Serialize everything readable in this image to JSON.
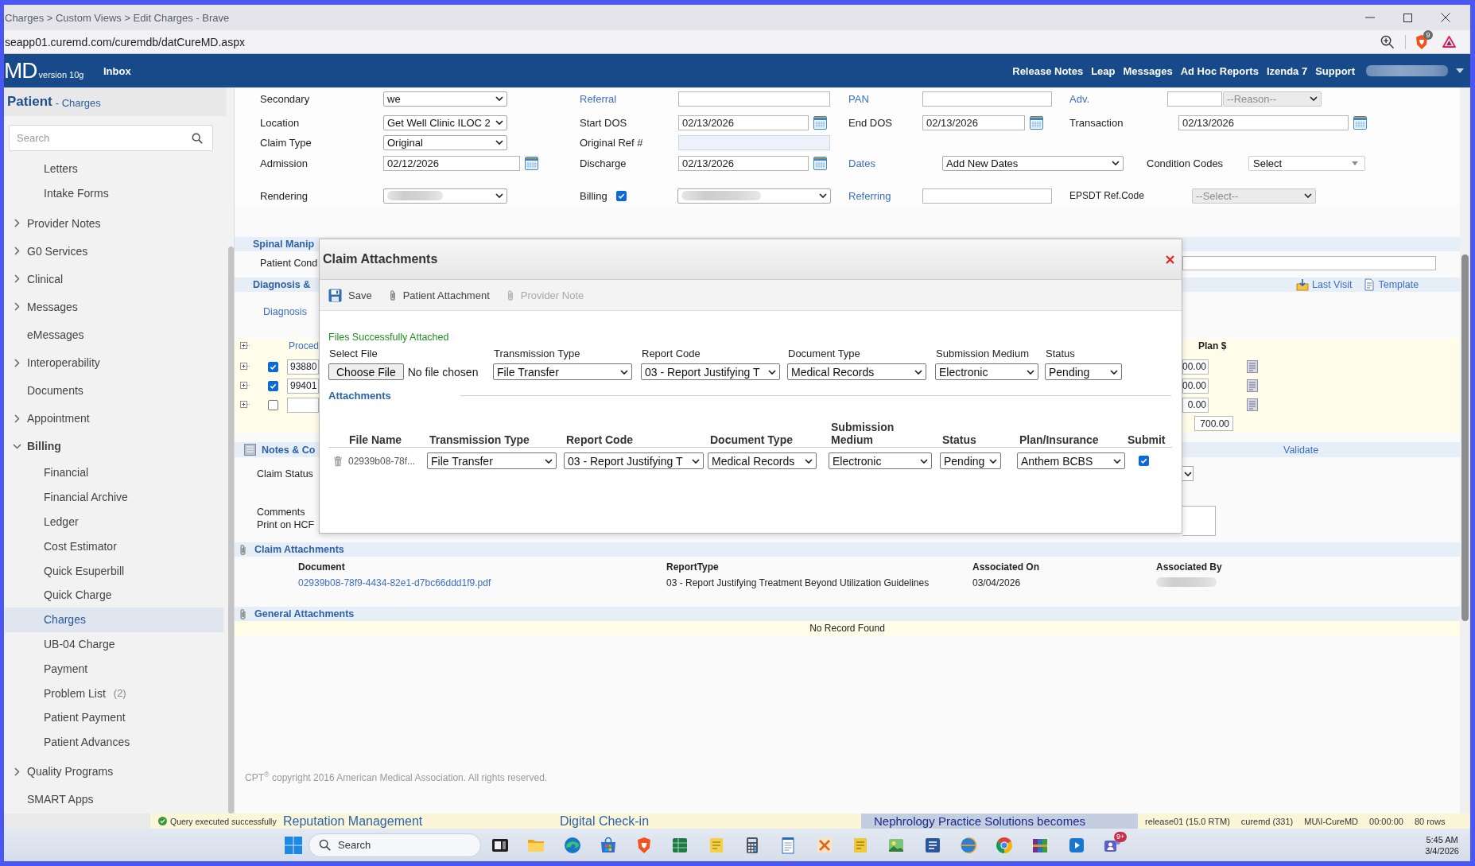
{
  "browser": {
    "title": "Charges > Custom Views > Edit Charges - Brave",
    "url": "seapp01.curemd.com/curemdb/datCureMD.aspx",
    "extension_badge": "9"
  },
  "app_bar": {
    "logo": "MD",
    "version": "version 10g",
    "menu": [
      "Inbox"
    ],
    "links": [
      "Release Notes",
      "Leap",
      "Messages",
      "Ad Hoc Reports",
      "Izenda 7",
      "Support"
    ]
  },
  "sidebar": {
    "title": "Patient",
    "subtitle": "- Charges",
    "search": {
      "placeholder": "Search"
    },
    "partial_group": {
      "children": [
        {
          "label": "Letters",
          "selected": false
        },
        {
          "label": "Intake Forms",
          "selected": false
        }
      ]
    },
    "items": [
      {
        "label": "Provider Notes",
        "kind": "group",
        "expanded": false,
        "selected": false
      },
      {
        "label": "G0 Services",
        "kind": "group",
        "expanded": false,
        "selected": false
      },
      {
        "label": "Clinical",
        "kind": "group",
        "expanded": false,
        "selected": false
      },
      {
        "label": "Messages",
        "kind": "group",
        "expanded": false,
        "selected": false
      },
      {
        "label": "eMessages",
        "kind": "link",
        "selected": false
      },
      {
        "label": "Interoperability",
        "kind": "group",
        "expanded": false,
        "selected": false
      },
      {
        "label": "Documents",
        "kind": "link",
        "selected": false
      },
      {
        "label": "Appointment",
        "kind": "group",
        "expanded": false,
        "selected": false
      },
      {
        "label": "Billing",
        "kind": "group",
        "expanded": true,
        "selected": false,
        "children": [
          {
            "label": "Financial",
            "selected": false
          },
          {
            "label": "Financial Archive",
            "selected": false
          },
          {
            "label": "Ledger",
            "selected": false
          },
          {
            "label": "Cost Estimator",
            "selected": false
          },
          {
            "label": "Quick Esuperbill",
            "selected": false
          },
          {
            "label": "Quick Charge",
            "selected": false
          },
          {
            "label": "Charges",
            "selected": true
          },
          {
            "label": "UB-04 Charge",
            "selected": false
          },
          {
            "label": "Payment",
            "selected": false
          },
          {
            "label": "Problem List",
            "count": "(2)",
            "selected": false
          },
          {
            "label": "Patient Payment",
            "selected": false
          },
          {
            "label": "Patient Advances",
            "selected": false
          }
        ]
      },
      {
        "label": "Quality Programs",
        "kind": "group",
        "expanded": false,
        "selected": false
      },
      {
        "label": "SMART Apps",
        "kind": "link",
        "selected": false
      }
    ]
  },
  "claim_form": {
    "rows": [
      {
        "fields": [
          {
            "label": "Secondary",
            "link": false,
            "controls": [
              {
                "kind": "select",
                "value": "we",
                "disabled": false
              }
            ]
          },
          {
            "label": "Referral",
            "link": true,
            "controls": [
              {
                "kind": "input",
                "disabled": false
              }
            ]
          },
          {
            "label": "PAN",
            "link": true,
            "controls": [
              {
                "kind": "input",
                "disabled": false
              }
            ]
          },
          {
            "label": "Adv.",
            "link": true,
            "controls": [
              {
                "kind": "input",
                "disabled": false
              },
              {
                "kind": "select",
                "value": "--Reason--",
                "disabled": true
              }
            ]
          }
        ]
      },
      {
        "fields": [
          {
            "label": "Location",
            "link": false,
            "controls": [
              {
                "kind": "select",
                "value": "Get Well Clinic ILOC 2",
                "disabled": false
              }
            ]
          },
          {
            "label": "Start DOS",
            "link": false,
            "controls": [
              {
                "kind": "date",
                "value": "02/13/2026"
              }
            ]
          },
          {
            "label": "End DOS",
            "link": false,
            "controls": [
              {
                "kind": "date",
                "value": "02/13/2026"
              }
            ]
          },
          {
            "label": "Transaction",
            "link": false,
            "controls": [
              {
                "kind": "date",
                "value": "02/13/2026"
              }
            ]
          }
        ]
      },
      {
        "fields": [
          {
            "label": "Claim Type",
            "link": false,
            "controls": [
              {
                "kind": "select",
                "value": "Original",
                "disabled": false
              }
            ]
          },
          {
            "label": "Original Ref #",
            "link": false,
            "controls": [
              {
                "kind": "input",
                "disabled": true
              }
            ]
          }
        ]
      },
      {
        "fields": [
          {
            "label": "Admission",
            "link": false,
            "controls": [
              {
                "kind": "date",
                "value": "02/12/2026"
              }
            ]
          },
          {
            "label": "Discharge",
            "link": false,
            "controls": [
              {
                "kind": "date",
                "value": "02/13/2026"
              }
            ]
          },
          {
            "label": "Dates",
            "link": true,
            "controls": [
              {
                "kind": "select",
                "value": "Add New Dates",
                "disabled": false
              }
            ]
          },
          {
            "label": "Condition Codes",
            "link": false,
            "controls": [
              {
                "kind": "combo",
                "value": "Select"
              }
            ]
          }
        ]
      },
      {
        "fields": [
          {
            "label": "Rendering",
            "link": false,
            "controls": [
              {
                "kind": "blurred_select"
              }
            ]
          },
          {
            "label": "Billing",
            "link": false,
            "controls": [
              {
                "kind": "checkbox",
                "checked": true
              },
              {
                "kind": "blurred_select"
              }
            ]
          },
          {
            "label": "Referring",
            "link": true,
            "controls": [
              {
                "kind": "input",
                "disabled": false
              }
            ]
          },
          {
            "label": "EPSDT Ref.Code",
            "link": false,
            "controls": [
              {
                "kind": "select",
                "value": "--Select--",
                "disabled": true
              }
            ]
          }
        ]
      }
    ]
  },
  "page": {
    "spinal_section": {
      "title": "Spinal Manip",
      "field_label": "Patient Cond"
    },
    "diagnosis_section": {
      "title": "Diagnosis &",
      "links": [
        "Last Visit",
        "Template"
      ],
      "tab": "Diagnosis"
    },
    "procedures": {
      "column_1": "Proced",
      "plan_header": "Plan $",
      "rows": [
        {
          "checked": true,
          "column_1": "93880",
          "plan": "00.00"
        },
        {
          "checked": true,
          "column_1": "99401",
          "plan": "00.00"
        },
        {
          "checked": false,
          "plan": "0.00"
        }
      ],
      "total": "700.00"
    },
    "notes_section": {
      "title": "Notes & Co",
      "action": "Validate",
      "status_label": "Claim Status",
      "comment_labels": [
        "Comments",
        "Print on HCF"
      ]
    },
    "claim_attachments": {
      "title": "Claim Attachments",
      "columns": [
        "Document",
        "ReportType",
        "Associated On",
        "Associated By"
      ],
      "rows": [
        {
          "document": "02939b08-78f9-4434-82e1-d7bc66ddd1f9.pdf",
          "report_type": "03 - Report Justifying Treatment Beyond Utilization Guidelines",
          "associated_on": "03/04/2026"
        }
      ]
    },
    "general_attachments": {
      "title": "General Attachments",
      "empty_message": "No Record Found"
    },
    "copyright": "CPT$^{®}$ copyright 2016 American Medical Association. All rights reserved."
  },
  "modal": {
    "title": "Claim Attachments",
    "toolbar": [
      {
        "kind": "save",
        "label": "Save",
        "disabled": false
      },
      {
        "kind": "attach",
        "label": "Patient Attachment",
        "disabled": false
      },
      {
        "kind": "attach",
        "label": "Provider Note",
        "disabled": true
      }
    ],
    "message": "Files Successfully Attached",
    "upload": [
      {
        "kind": "file",
        "label": "Select File",
        "button": "Choose File",
        "status": "No file chosen"
      },
      {
        "kind": "select",
        "label": "Transmission Type",
        "value": "File Transfer"
      },
      {
        "kind": "select",
        "label": "Report Code",
        "value": "03 - Report Justifying T"
      },
      {
        "kind": "select",
        "label": "Document Type",
        "value": "Medical Records"
      },
      {
        "kind": "select",
        "label": "Submission Medium",
        "value": "Electronic"
      },
      {
        "kind": "select",
        "label": "Status",
        "value": "Pending"
      }
    ],
    "attachments_title": "Attachments",
    "table": {
      "columns": [
        "File Name",
        "Transmission Type",
        "Report Code",
        "Document Type",
        "Submission Medium",
        "Status",
        "Plan/Insurance",
        "Submit"
      ],
      "rows": [
        {
          "file_name": "02939b08-78f...",
          "transmission_type": "File Transfer",
          "report_code": "03 - Report Justifying T",
          "document_type": "Medical Records",
          "submission_medium": "Electronic",
          "status": "Pending",
          "plan_insurance": "Anthem BCBS",
          "submit": true
        }
      ]
    }
  },
  "background_window": {
    "status": "Query executed successfully",
    "headlines": [
      "Reputation Management",
      "Digital Check-in",
      "Nephrology Practice Solutions becomes"
    ],
    "status_items": [
      "release01 (15.0 RTM)",
      "curemd (331)",
      "MU\\I-CureMD",
      "00:00:00",
      "80 rows"
    ]
  },
  "taskbar": {
    "search": {
      "placeholder": "Search"
    },
    "badge": "9+",
    "time": "5:45 AM",
    "date": "3/4/2026"
  }
}
